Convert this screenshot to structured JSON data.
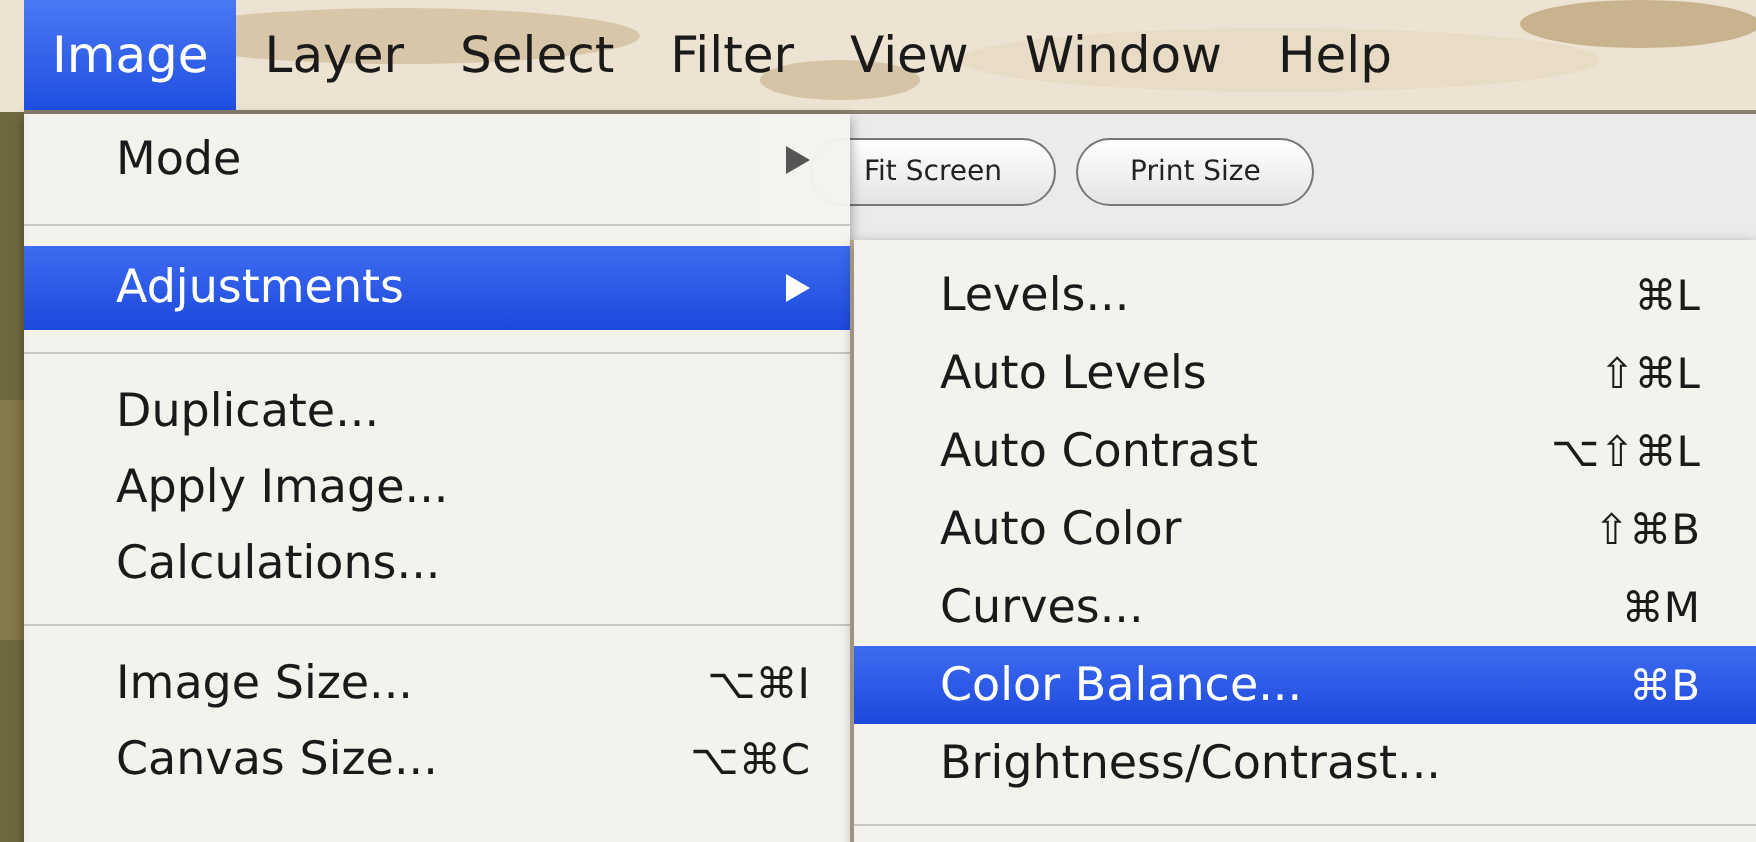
{
  "menubar": [
    {
      "label": "Image",
      "selected": true
    },
    {
      "label": "Layer",
      "selected": false
    },
    {
      "label": "Select",
      "selected": false
    },
    {
      "label": "Filter",
      "selected": false
    },
    {
      "label": "View",
      "selected": false
    },
    {
      "label": "Window",
      "selected": false
    },
    {
      "label": "Help",
      "selected": false
    }
  ],
  "toolbar": {
    "buttons": [
      "Fit Screen",
      "Print Size"
    ]
  },
  "menu": {
    "items": [
      {
        "kind": "item",
        "label": "Mode",
        "submenu": true,
        "selected": false
      },
      {
        "kind": "separator"
      },
      {
        "kind": "item",
        "label": "Adjustments",
        "submenu": true,
        "selected": true
      },
      {
        "kind": "separator"
      },
      {
        "kind": "item",
        "label": "Duplicate...",
        "submenu": false,
        "selected": false
      },
      {
        "kind": "item",
        "label": "Apply Image...",
        "submenu": false,
        "selected": false
      },
      {
        "kind": "item",
        "label": "Calculations...",
        "submenu": false,
        "selected": false
      },
      {
        "kind": "separator"
      },
      {
        "kind": "item",
        "label": "Image Size...",
        "shortcut": "⌥⌘I",
        "submenu": false,
        "selected": false
      },
      {
        "kind": "item",
        "label": "Canvas Size...",
        "shortcut": "⌥⌘C",
        "submenu": false,
        "selected": false
      }
    ]
  },
  "submenu": {
    "items": [
      {
        "kind": "item",
        "label": "Levels...",
        "shortcut": "⌘L",
        "selected": false
      },
      {
        "kind": "item",
        "label": "Auto Levels",
        "shortcut": "⇧⌘L",
        "selected": false
      },
      {
        "kind": "item",
        "label": "Auto Contrast",
        "shortcut": "⌥⇧⌘L",
        "selected": false
      },
      {
        "kind": "item",
        "label": "Auto Color",
        "shortcut": "⇧⌘B",
        "selected": false
      },
      {
        "kind": "item",
        "label": "Curves...",
        "shortcut": "⌘M",
        "selected": false
      },
      {
        "kind": "item",
        "label": "Color Balance...",
        "shortcut": "⌘B",
        "selected": true
      },
      {
        "kind": "item",
        "label": "Brightness/Contrast...",
        "selected": false
      },
      {
        "kind": "separator"
      }
    ]
  }
}
